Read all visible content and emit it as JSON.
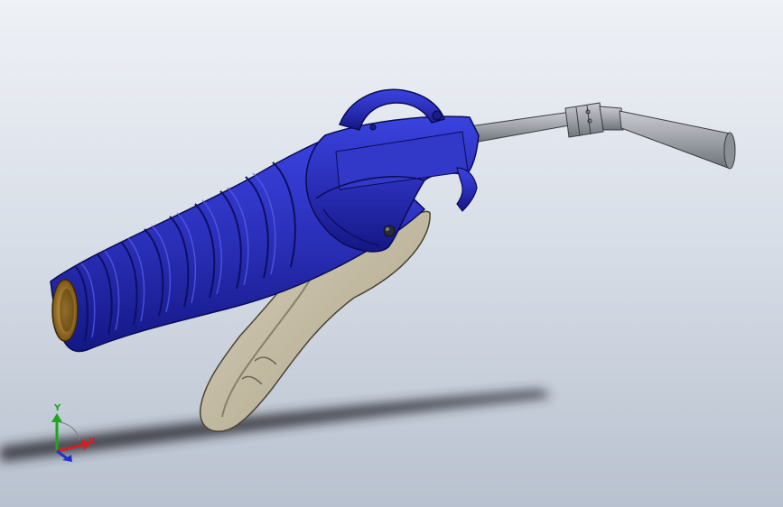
{
  "viewport": {
    "background_top": "#eef1f6",
    "background_bottom": "#b8c1cf"
  },
  "model": {
    "body_color": "#2a2fb8",
    "body_dark": "#12157a",
    "trigger_color": "#bdb49c",
    "trigger_dark": "#6f6650",
    "nozzle_color": "#9ea2a9",
    "thread_color": "#b8862e"
  },
  "triad": {
    "x_label": "X",
    "y_label": "Y",
    "x_color": "#d21f1f",
    "y_color": "#1fa51f",
    "z_color": "#2431c9"
  }
}
